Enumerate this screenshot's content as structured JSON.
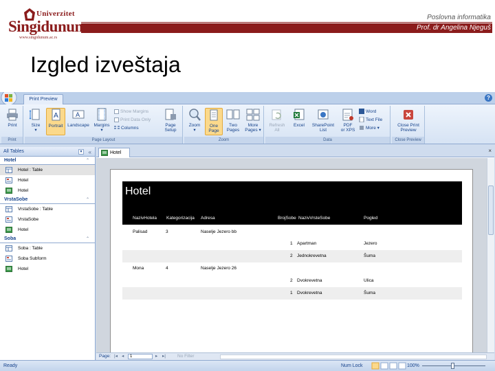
{
  "slide": {
    "logo_university": "Univerzitet",
    "logo_name": "Singidunum",
    "logo_url": "www.singidunum.ac.rs",
    "course": "Poslovna informatika",
    "author": "Prof. dr Angelina Njeguš",
    "title": "Izgled izveštaja"
  },
  "colors": {
    "brand": "#8b1c1c",
    "ribbon": "#d6e3f4",
    "active_button": "#fbd98b",
    "report_band": "#000000"
  },
  "ribbon": {
    "tab": "Print Preview",
    "groups": {
      "print": "Print",
      "page_layout": "Page Layout",
      "zoom": "Zoom",
      "data": "Data",
      "close_preview": "Close Preview"
    },
    "buttons": {
      "print": "Print",
      "size": "Size",
      "portrait": "Portrait",
      "landscape": "Landscape",
      "margins": "Margins",
      "page_setup_1": "Page",
      "page_setup_2": "Setup",
      "zoom": "Zoom",
      "one_page_1": "One",
      "one_page_2": "Page",
      "two_pages_1": "Two",
      "two_pages_2": "Pages",
      "more_pages_1": "More",
      "more_pages_2": "Pages",
      "refresh_1": "Refresh",
      "refresh_2": "All",
      "excel": "Excel",
      "sharepoint_1": "SharePoint",
      "sharepoint_2": "List",
      "pdf_1": "PDF",
      "pdf_2": "or XPS",
      "word": "Word",
      "text_file": "Text File",
      "more": "More",
      "close_print_1": "Close Print",
      "close_print_2": "Preview"
    },
    "options": {
      "show_margins": "Show Margins",
      "print_data_only": "Print Data Only",
      "columns": "Columns"
    }
  },
  "nav": {
    "header": "All Tables",
    "groups": [
      {
        "name": "Hotel",
        "items": [
          "Hotel : Table",
          "Hotel",
          "Hotel"
        ]
      },
      {
        "name": "VrstaSobe",
        "items": [
          "VrstaSobe : Table",
          "VrstaSobe",
          "Hotel"
        ]
      },
      {
        "name": "Soba",
        "items": [
          "Soba : Table",
          "Soba Subform",
          "Hotel"
        ]
      }
    ]
  },
  "document": {
    "tab": "Hotel"
  },
  "report": {
    "title": "Hotel",
    "columns": [
      "NazivHotela",
      "Kategorizacija",
      "Adresa",
      "BrojSobe",
      "NazivVrsteSobe",
      "Pogled"
    ],
    "rows": [
      {
        "hotel": "Palisad",
        "kat": "3",
        "adresa": "Naselje Jezero bb",
        "broj": "",
        "vrsta": "",
        "pogled": ""
      },
      {
        "hotel": "",
        "kat": "",
        "adresa": "",
        "broj": "1",
        "vrsta": "Apartman",
        "pogled": "Jezero"
      },
      {
        "hotel": "",
        "kat": "",
        "adresa": "",
        "broj": "2",
        "vrsta": "Jednokrevetna",
        "pogled": "Šuma"
      },
      {
        "hotel": "Mona",
        "kat": "4",
        "adresa": "Naselje Jezero 26",
        "broj": "",
        "vrsta": "",
        "pogled": ""
      },
      {
        "hotel": "",
        "kat": "",
        "adresa": "",
        "broj": "2",
        "vrsta": "Dvokrevetna",
        "pogled": "Ulica"
      },
      {
        "hotel": "",
        "kat": "",
        "adresa": "",
        "broj": "1",
        "vrsta": "Dvokrevetna",
        "pogled": "Šuma"
      }
    ]
  },
  "recnav": {
    "label": "Page:",
    "value": "1",
    "filter": "No Filter"
  },
  "status": {
    "text": "Ready",
    "numlock": "Num Lock",
    "zoom": "100%"
  }
}
